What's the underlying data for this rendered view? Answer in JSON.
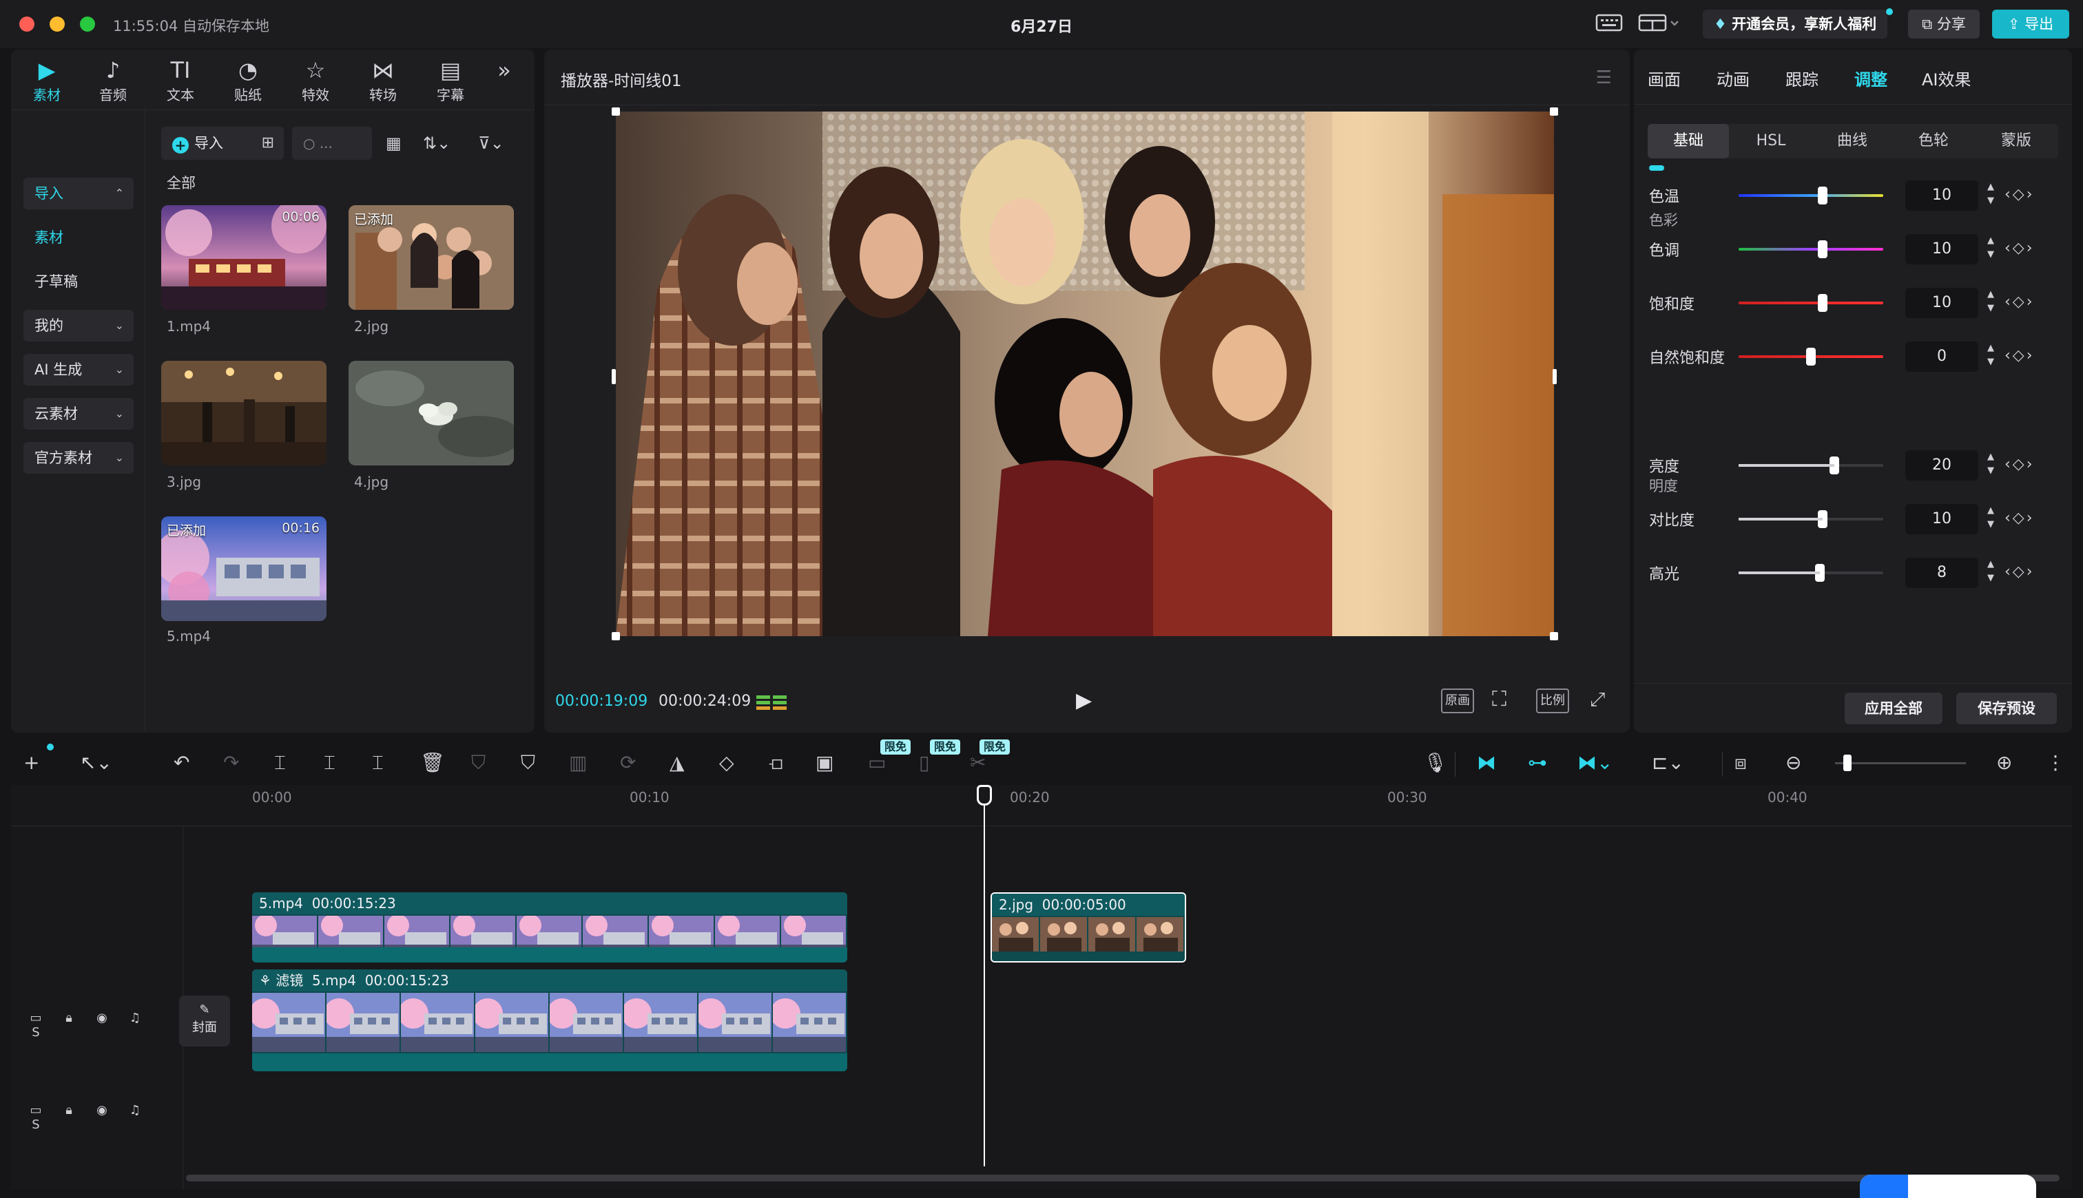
{
  "titlebar": {
    "autosave": "11:55:04 自动保存本地",
    "title": "6月27日",
    "vip": "开通会员，享新人福利",
    "share": "分享",
    "export": "导出"
  },
  "toolbar_tabs": [
    {
      "label": "素材",
      "icon": "media-icon"
    },
    {
      "label": "音频",
      "icon": "audio-icon"
    },
    {
      "label": "文本",
      "icon": "text-icon"
    },
    {
      "label": "贴纸",
      "icon": "sticker-icon"
    },
    {
      "label": "特效",
      "icon": "effects-icon"
    },
    {
      "label": "转场",
      "icon": "transition-icon"
    },
    {
      "label": "字幕",
      "icon": "subtitle-icon"
    }
  ],
  "sidenav": {
    "import": "导入",
    "media": "素材",
    "draft": "子草稿",
    "mine": "我的",
    "ai": "AI 生成",
    "cloud": "云素材",
    "official": "官方素材"
  },
  "library": {
    "import_button": "导入",
    "search_placeholder": "...",
    "all_label": "全部",
    "items": [
      {
        "name": "1.mp4",
        "badge": "",
        "duration": "00:06"
      },
      {
        "name": "2.jpg",
        "badge": "已添加",
        "duration": ""
      },
      {
        "name": "3.jpg",
        "badge": "",
        "duration": ""
      },
      {
        "name": "4.jpg",
        "badge": "",
        "duration": ""
      },
      {
        "name": "5.mp4",
        "badge": "已添加",
        "duration": "00:16"
      }
    ]
  },
  "player": {
    "title": "播放器-时间线01",
    "current_time": "00:00:19:09",
    "total_time": "00:00:24:09",
    "original_label": "原画",
    "ratio_label": "比例"
  },
  "right_panel": {
    "tabs": [
      "画面",
      "动画",
      "跟踪",
      "调整",
      "AI效果"
    ],
    "active_tab": "调整",
    "subtabs": [
      "基础",
      "HSL",
      "曲线",
      "色轮",
      "蒙版"
    ],
    "active_subtab": "基础",
    "section_color": "色彩",
    "section_brightness": "明度",
    "rows": [
      {
        "label": "色温",
        "value": "10",
        "level": 0.58
      },
      {
        "label": "色调",
        "value": "10",
        "level": 0.58
      },
      {
        "label": "饱和度",
        "value": "10",
        "level": 0.58
      },
      {
        "label": "自然饱和度",
        "value": "0",
        "level": 0.5
      },
      {
        "label": "亮度",
        "value": "20",
        "level": 0.66
      },
      {
        "label": "对比度",
        "value": "10",
        "level": 0.58
      },
      {
        "label": "高光",
        "value": "8",
        "level": 0.56
      }
    ],
    "apply_all": "应用全部",
    "save_preset": "保存预设"
  },
  "timeline_toolbar": {
    "free_badge": "限免"
  },
  "timeline": {
    "ruler": [
      "00:00",
      "00:10",
      "00:20",
      "00:30",
      "00:40"
    ],
    "track_head_solo": "S",
    "cover_label": "封面",
    "clips": {
      "top_a_name": "5.mp4",
      "top_a_dur": "00:00:15:23",
      "top_b_name": "2.jpg",
      "top_b_dur": "00:00:05:00",
      "main_filter": "滤镜",
      "main_name": "5.mp4",
      "main_dur": "00:00:15:23"
    }
  },
  "colors": {
    "accent": "#2fd8ea",
    "clip_fill": "#0e4a4e",
    "panel_bg": "#1e1e21"
  }
}
